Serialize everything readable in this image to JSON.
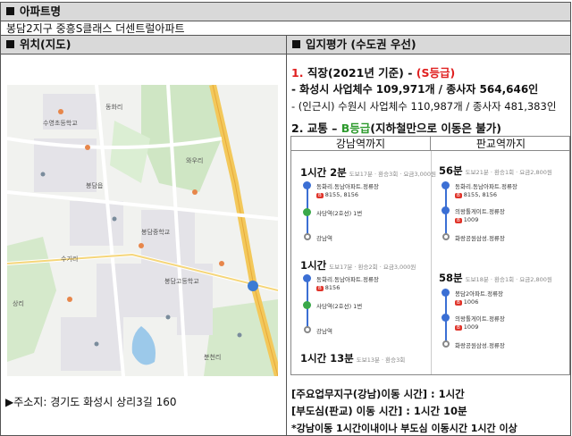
{
  "apt_header": "아파트명",
  "apt_name": "봉담2지구 중흥S클래스 더센트럴아파트",
  "loc_header": "위치(지도)",
  "eval_header": "입지평가 (수도권 우선)",
  "jobs": {
    "num": "1.",
    "title": "직장(2021년 기준) - ",
    "grade": "(S등급)",
    "line1": "- 화성시 사업체수 109,971개 / 종사자 564,646인",
    "line2": "- (인근시) 수원시 사업체수 110,987개 / 종사자 481,383인"
  },
  "transport": {
    "title_a": "2. 교통 – ",
    "grade": "B등급",
    "title_b": "(지하철만으로 이동은 불가)"
  },
  "routes": {
    "gangnam_head": "강남역까지",
    "pangyo_head": "판교역까지",
    "gangnam": [
      {
        "time": "1시간 2분",
        "meta": "도보17분 · 환승3회 · 요금3,000원",
        "stops": [
          "동화리.동남아파트.정류장",
          "8155, 8156",
          "사당역(2호선) 1번",
          "강남역"
        ]
      },
      {
        "time": "1시간",
        "meta": "도보17분 · 환승2회 · 요금3,000원",
        "stops": [
          "동화리.동남아파트.정류장",
          "8156",
          "사당역(2호선) 1번",
          "강남역"
        ]
      },
      {
        "time": "1시간 13분",
        "meta": "도보13분 · 환승3회"
      }
    ],
    "pangyo": [
      {
        "time": "56분",
        "meta": "도보21분 · 환승1회 · 요금2,800원",
        "stops": [
          "동화리.동남아파트.정류장",
          "8155, 8156",
          "의왕톨게이트.정류장",
          "1009",
          "화랑공원삼성.정류장"
        ]
      },
      {
        "time": "58분",
        "meta": "도보18분 · 환승1회 · 요금2,800원",
        "stops": [
          "봉담2아파트.정류장",
          "1006",
          "의왕톨게이트.정류장",
          "1009",
          "화랑공원삼성.정류장"
        ]
      }
    ]
  },
  "address": "▶주소지: 경기도 화성시 상리3길 160",
  "times": {
    "line1": "[주요업무지구(강남)이동 시간] : 1시간",
    "line2": "[부도심(판교) 이동 시간] : 1시간 10분",
    "line3": "*강남이동 1시간이내이나 부도심 이동시간 1시간 이상"
  },
  "map_labels": [
    "봉담읍",
    "수영초등학교",
    "봉담중학교",
    "봉담고등학교",
    "상리",
    "동화리",
    "와우리",
    "수기리",
    "분천리"
  ]
}
